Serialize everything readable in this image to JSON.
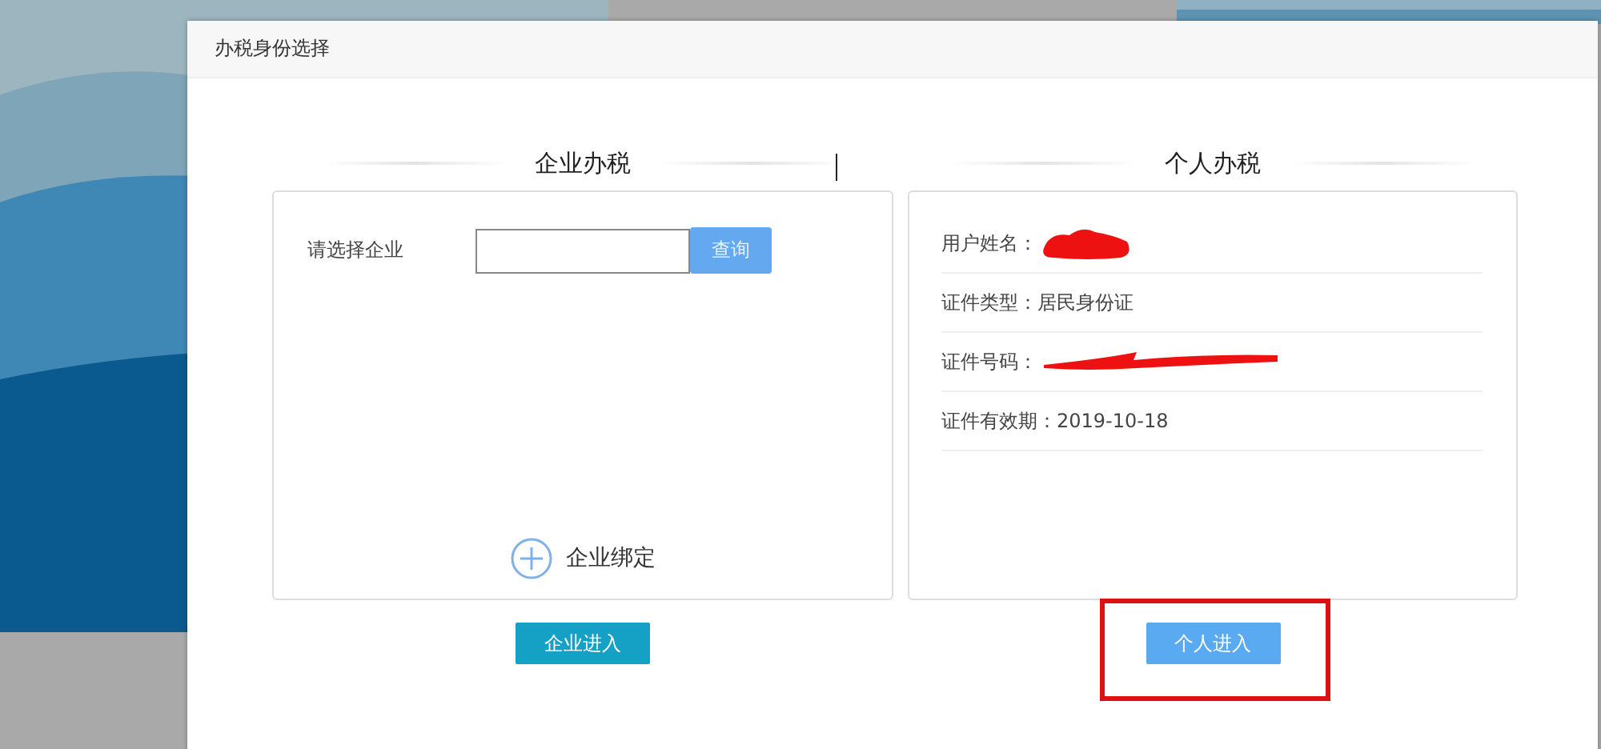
{
  "dialog": {
    "title": "办税身份选择",
    "enterprise": {
      "heading": "企业办税",
      "field_label": "请选择企业",
      "search_button": "查询",
      "bind_link": "企业绑定",
      "enter_button": "企业进入"
    },
    "personal": {
      "heading": "个人办税",
      "rows": [
        {
          "label": "用户姓名：",
          "redacted": true,
          "kind": "blob"
        },
        {
          "label": "证件类型：",
          "value": "居民身份证",
          "redacted": false
        },
        {
          "label": "证件号码：",
          "redacted": true,
          "kind": "line"
        },
        {
          "label": "证件有效期：",
          "value": "2019-10-18",
          "redacted": false
        }
      ],
      "enter_button": "个人进入",
      "highlighted": true
    }
  }
}
